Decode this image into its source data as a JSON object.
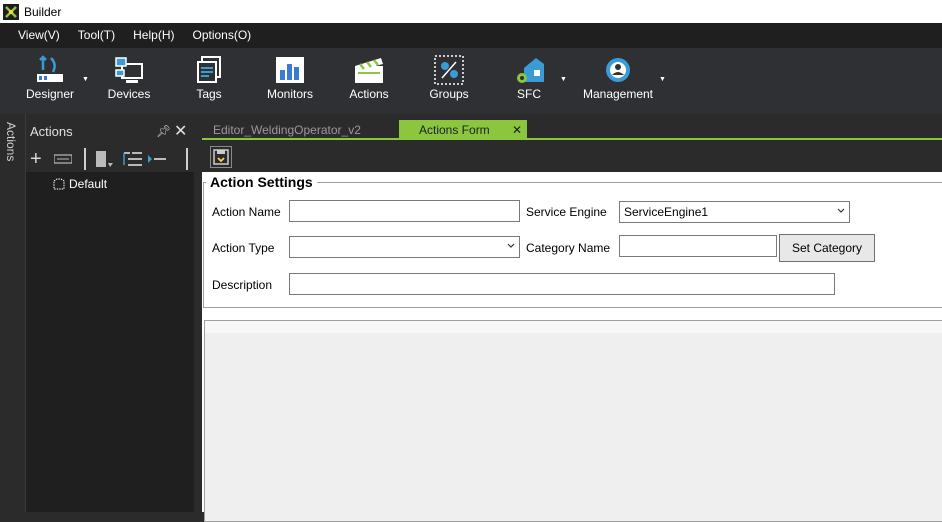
{
  "window": {
    "title": "Builder"
  },
  "menu": [
    "View(V)",
    "Tool(T)",
    "Help(H)",
    "Options(O)"
  ],
  "toolbar": {
    "designer": "Designer",
    "devices": "Devices",
    "tags": "Tags",
    "monitors": "Monitors",
    "actions": "Actions",
    "groups": "Groups",
    "sfc": "SFC",
    "management": "Management"
  },
  "side_tab": "Actions",
  "actions_panel": {
    "title": "Actions",
    "tree": [
      "Default"
    ]
  },
  "tabs": {
    "editor": "Editor_WeldingOperator_v2",
    "active": "Actions Form"
  },
  "form": {
    "section_title": "Action Settings",
    "action_name_label": "Action Name",
    "action_name_value": "",
    "service_engine_label": "Service Engine",
    "service_engine_value": "ServiceEngine1",
    "action_type_label": "Action Type",
    "action_type_value": "",
    "category_name_label": "Category Name",
    "category_name_value": "",
    "set_category_button": "Set Category",
    "description_label": "Description",
    "description_value": ""
  },
  "colors": {
    "accent": "#8cc63f",
    "toolbar_bg": "#2f3033",
    "menu_bg": "#1f1f1f",
    "panel_bg": "#1f1f1f"
  }
}
